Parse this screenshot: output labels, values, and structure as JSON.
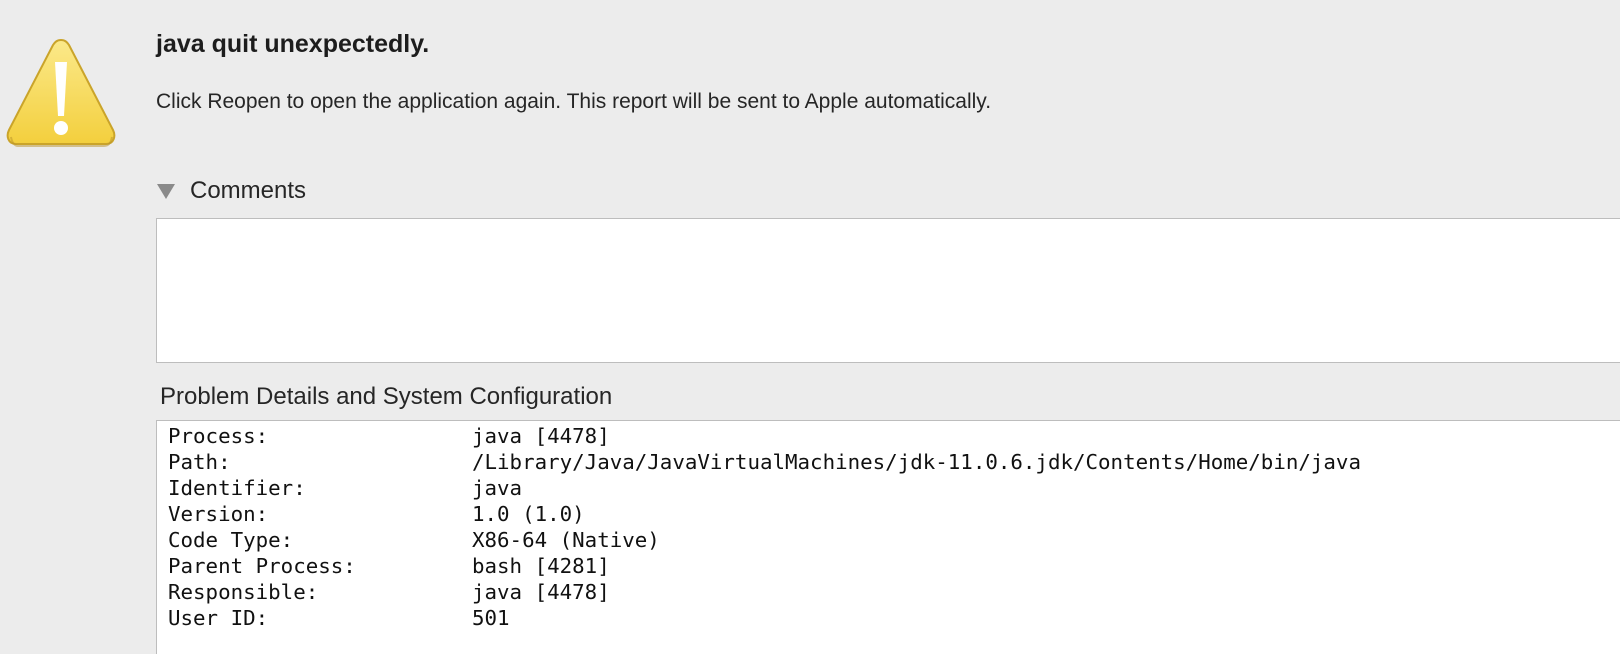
{
  "dialog": {
    "title": "java quit unexpectedly.",
    "message": "Click Reopen to open the application again. This report will be sent to Apple automatically.",
    "icon": "warning-icon",
    "accent_color": "#f6d64a"
  },
  "comments": {
    "label": "Comments",
    "value": "",
    "expanded": true
  },
  "details": {
    "label": "Problem Details and System Configuration",
    "rows": [
      {
        "key": "Process:",
        "value": "java [4478]"
      },
      {
        "key": "Path:",
        "value": "/Library/Java/JavaVirtualMachines/jdk-11.0.6.jdk/Contents/Home/bin/java"
      },
      {
        "key": "Identifier:",
        "value": "java"
      },
      {
        "key": "Version:",
        "value": "1.0 (1.0)"
      },
      {
        "key": "Code Type:",
        "value": "X86-64 (Native)"
      },
      {
        "key": "Parent Process:",
        "value": "bash [4281]"
      },
      {
        "key": "Responsible:",
        "value": "java [4478]"
      },
      {
        "key": "User ID:",
        "value": "501"
      }
    ]
  }
}
